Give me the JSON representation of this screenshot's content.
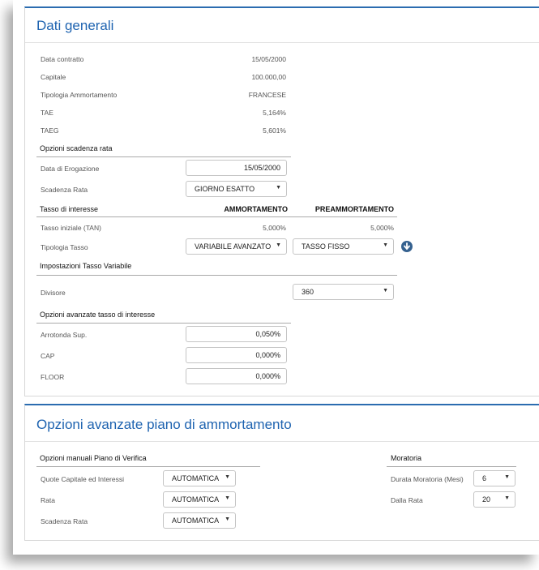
{
  "dati_generali": {
    "title": "Dati generali",
    "rows": [
      {
        "label": "Data contratto",
        "value": "15/05/2000"
      },
      {
        "label": "Capitale",
        "value": "100.000,00"
      },
      {
        "label": "Tipologia Ammortamento",
        "value": "FRANCESE"
      },
      {
        "label": "TAE",
        "value": "5,164%"
      },
      {
        "label": "TAEG",
        "value": "5,601%"
      }
    ],
    "opzioni_scadenza": {
      "heading": "Opzioni scadenza rata",
      "data_erogazione_label": "Data di Erogazione",
      "data_erogazione_value": "15/05/2000",
      "scadenza_rata_label": "Scadenza Rata",
      "scadenza_rata_value": "GIORNO ESATTO"
    },
    "tasso": {
      "heading": "Tasso di interesse",
      "col_ammortamento": "AMMORTAMENTO",
      "col_preammortamento": "PREAMMORTAMENTO",
      "tasso_iniziale_label": "Tasso iniziale (TAN)",
      "tasso_iniziale_amm": "5,000%",
      "tasso_iniziale_pre": "5,000%",
      "tipologia_label": "Tipologia Tasso",
      "tipologia_amm": "VARIABILE AVANZATO",
      "tipologia_pre": "TASSO FISSO"
    },
    "tasso_variabile": {
      "heading": "Impostazioni Tasso Variabile",
      "divisore_label": "Divisore",
      "divisore_value": "360"
    },
    "opzioni_avanzate_tasso": {
      "heading": "Opzioni avanzate tasso di interesse",
      "arrotonda_label": "Arrotonda Sup.",
      "arrotonda_value": "0,050%",
      "cap_label": "CAP",
      "cap_value": "0,000%",
      "floor_label": "FLOOR",
      "floor_value": "0,000%"
    }
  },
  "piano": {
    "title": "Opzioni avanzate piano di ammortamento",
    "manuali": {
      "heading": "Opzioni manuali Piano di Verifica",
      "quote_label": "Quote Capitale ed Interessi",
      "quote_value": "AUTOMATICA",
      "rata_label": "Rata",
      "rata_value": "AUTOMATICA",
      "scadenza_label": "Scadenza Rata",
      "scadenza_value": "AUTOMATICA"
    },
    "moratoria": {
      "heading": "Moratoria",
      "durata_label": "Durata Moratoria (Mesi)",
      "durata_value": "6",
      "dalla_label": "Dalla Rata",
      "dalla_value": "20"
    }
  },
  "icons": {
    "select_arrow": "▼",
    "expand_icon": "circle-arrow-down"
  }
}
